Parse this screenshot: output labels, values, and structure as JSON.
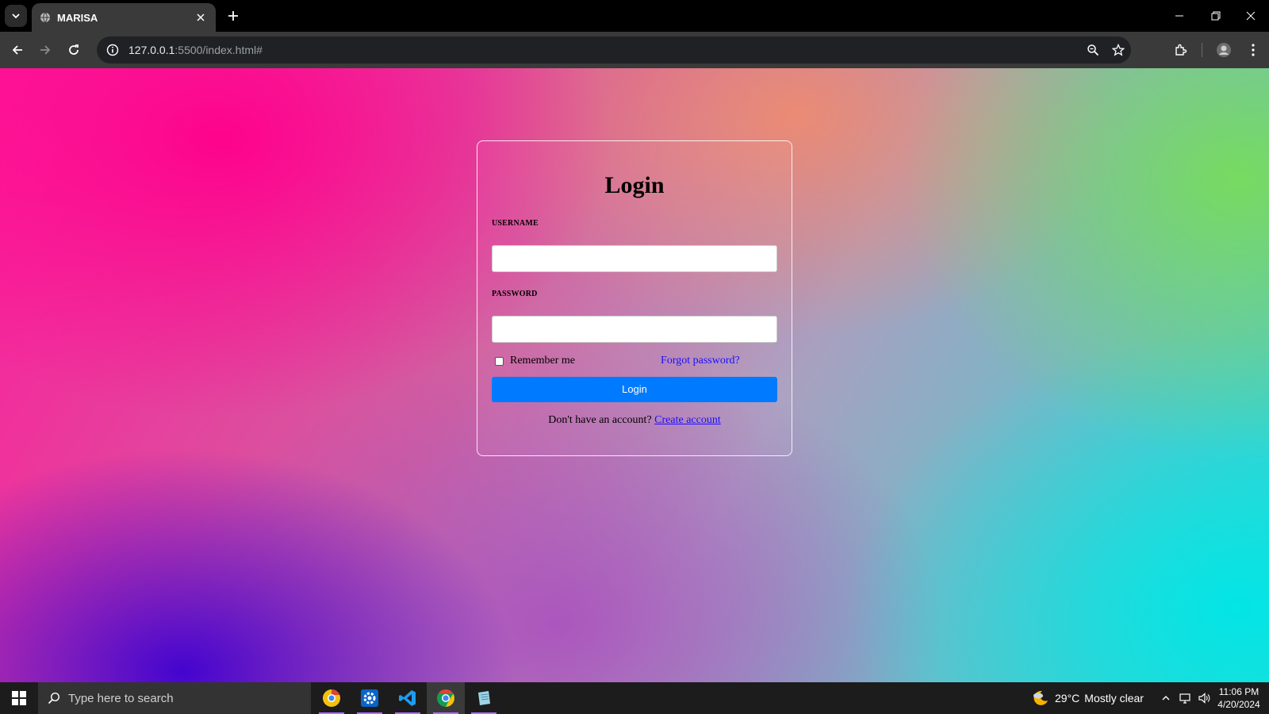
{
  "browser": {
    "tab_title": "MARISA",
    "url_host": "127.0.0.1",
    "url_rest": ":5500/index.html#"
  },
  "page": {
    "title": "Login",
    "username_label": "USERNAME",
    "password_label": "PASSWORD",
    "username_value": "",
    "password_value": "",
    "remember_label": "Remember me",
    "forgot_link": "Forgot password?",
    "login_button": "Login",
    "signup_prompt": "Don't have an account?",
    "create_link": "Create account",
    "colors": {
      "button": "#007bff",
      "link": "#1a0dff"
    }
  },
  "taskbar": {
    "search_placeholder": "Type here to search",
    "temperature": "29°C",
    "weather": "Mostly clear",
    "time": "11:06 PM",
    "date": "4/20/2024"
  }
}
